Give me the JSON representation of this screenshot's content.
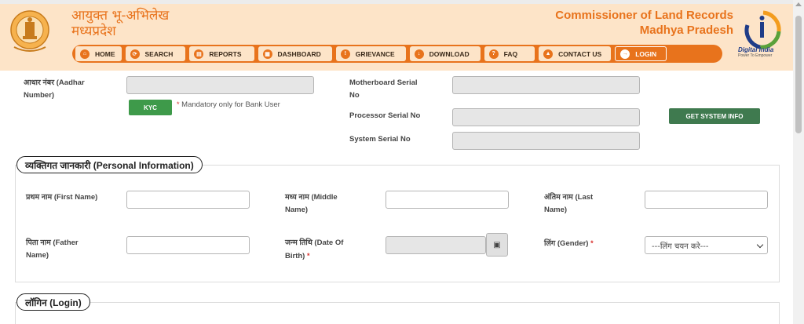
{
  "header": {
    "hindi_title_line1": "आयुक्त भू-अभिलेख",
    "hindi_title_line2": "मध्यप्रदेश",
    "eng_title_line1": "Commissioner of Land Records",
    "eng_title_line2": "Madhya Pradesh",
    "digital_india": "Digital India",
    "digital_india_tagline": "Power To Empower",
    "accent_color": "#e8731c"
  },
  "nav": {
    "items": [
      {
        "label": "HOME",
        "icon": "home-icon"
      },
      {
        "label": "SEARCH",
        "icon": "search-icon"
      },
      {
        "label": "REPORTS",
        "icon": "report-icon"
      },
      {
        "label": "DASHBOARD",
        "icon": "dashboard-icon"
      },
      {
        "label": "GRIEVANCE",
        "icon": "grievance-icon"
      },
      {
        "label": "DOWNLOAD",
        "icon": "download-icon"
      },
      {
        "label": "FAQ",
        "icon": "faq-icon"
      },
      {
        "label": "CONTACT US",
        "icon": "contact-icon"
      },
      {
        "label": "LOGIN",
        "icon": "login-icon"
      }
    ]
  },
  "system": {
    "aadhar_label_line1": "आधार नंबर (Aadhar",
    "aadhar_label_line2": "Number)",
    "kyc_button": "KYC",
    "mandatory_note": "Mandatory only for Bank User",
    "motherboard_label_line1": "Motherboard Serial",
    "motherboard_label_line2": "No",
    "processor_label": "Processor Serial No",
    "system_serial_label": "System Serial No",
    "get_system_info_button": "GET SYSTEM INFO"
  },
  "personal": {
    "legend": "व्यक्तिगत जानकारी (Personal Information)",
    "first_name_label": "प्रथम नाम (First Name)",
    "middle_name_label_line1": "मध्य नाम (Middle",
    "middle_name_label_line2": "Name)",
    "last_name_label_line1": "अंतिम नाम (Last",
    "last_name_label_line2": "Name)",
    "father_name_label_line1": "पिता नाम (Father",
    "father_name_label_line2": "Name)",
    "dob_label_line1": "जन्म तिथि (Date Of",
    "dob_label_line2": "Birth)",
    "gender_label": "लिंग (Gender)",
    "gender_selected": "---लिंग चयन करे---"
  },
  "login": {
    "legend": "लॉगिन (Login)"
  },
  "required_mark": "*"
}
